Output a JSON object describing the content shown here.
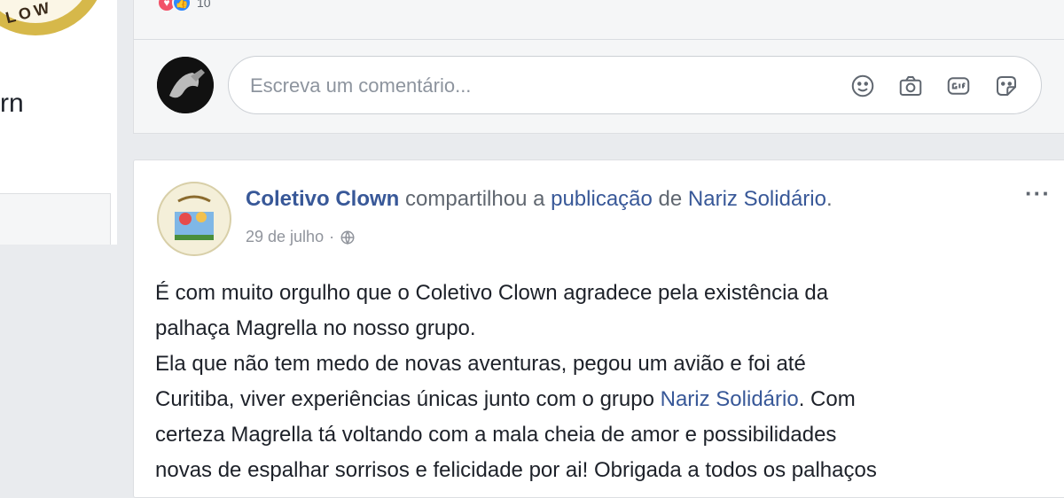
{
  "left": {
    "logo_text": "LOW",
    "partial_text": "rn"
  },
  "top_post": {
    "reaction_count": "10",
    "comment_placeholder": "Escreva um comentário...",
    "icons": [
      "emoji-icon",
      "camera-icon",
      "gif-icon",
      "sticker-icon"
    ]
  },
  "post": {
    "author": "Coletivo Clown",
    "shared_text": "compartilhou a",
    "publication_link": "publicação",
    "of_text": "de",
    "original_page": "Nariz Solidário",
    "period": ".",
    "date": "29 de julho",
    "dot": "·",
    "more": "···",
    "body": {
      "line1": "É com muito orgulho que o Coletivo Clown agradece pela existência da",
      "line2": "palhaça Magrella no nosso grupo.",
      "line3": "Ela que não tem medo de novas aventuras, pegou um avião e foi até",
      "line4_a": "Curitiba, viver experiências únicas junto com o grupo",
      "line4_link": "Nariz Solidário",
      "line4_b": ". Com",
      "line5": "certeza Magrella tá voltando com a mala cheia de amor e possibilidades",
      "line6": "novas de espalhar sorrisos e felicidade por ai! Obrigada a todos os palhaços"
    }
  },
  "colors": {
    "link": "#385898",
    "background": "#e9ebee",
    "love": "#f25268",
    "like": "#2d88ff"
  }
}
